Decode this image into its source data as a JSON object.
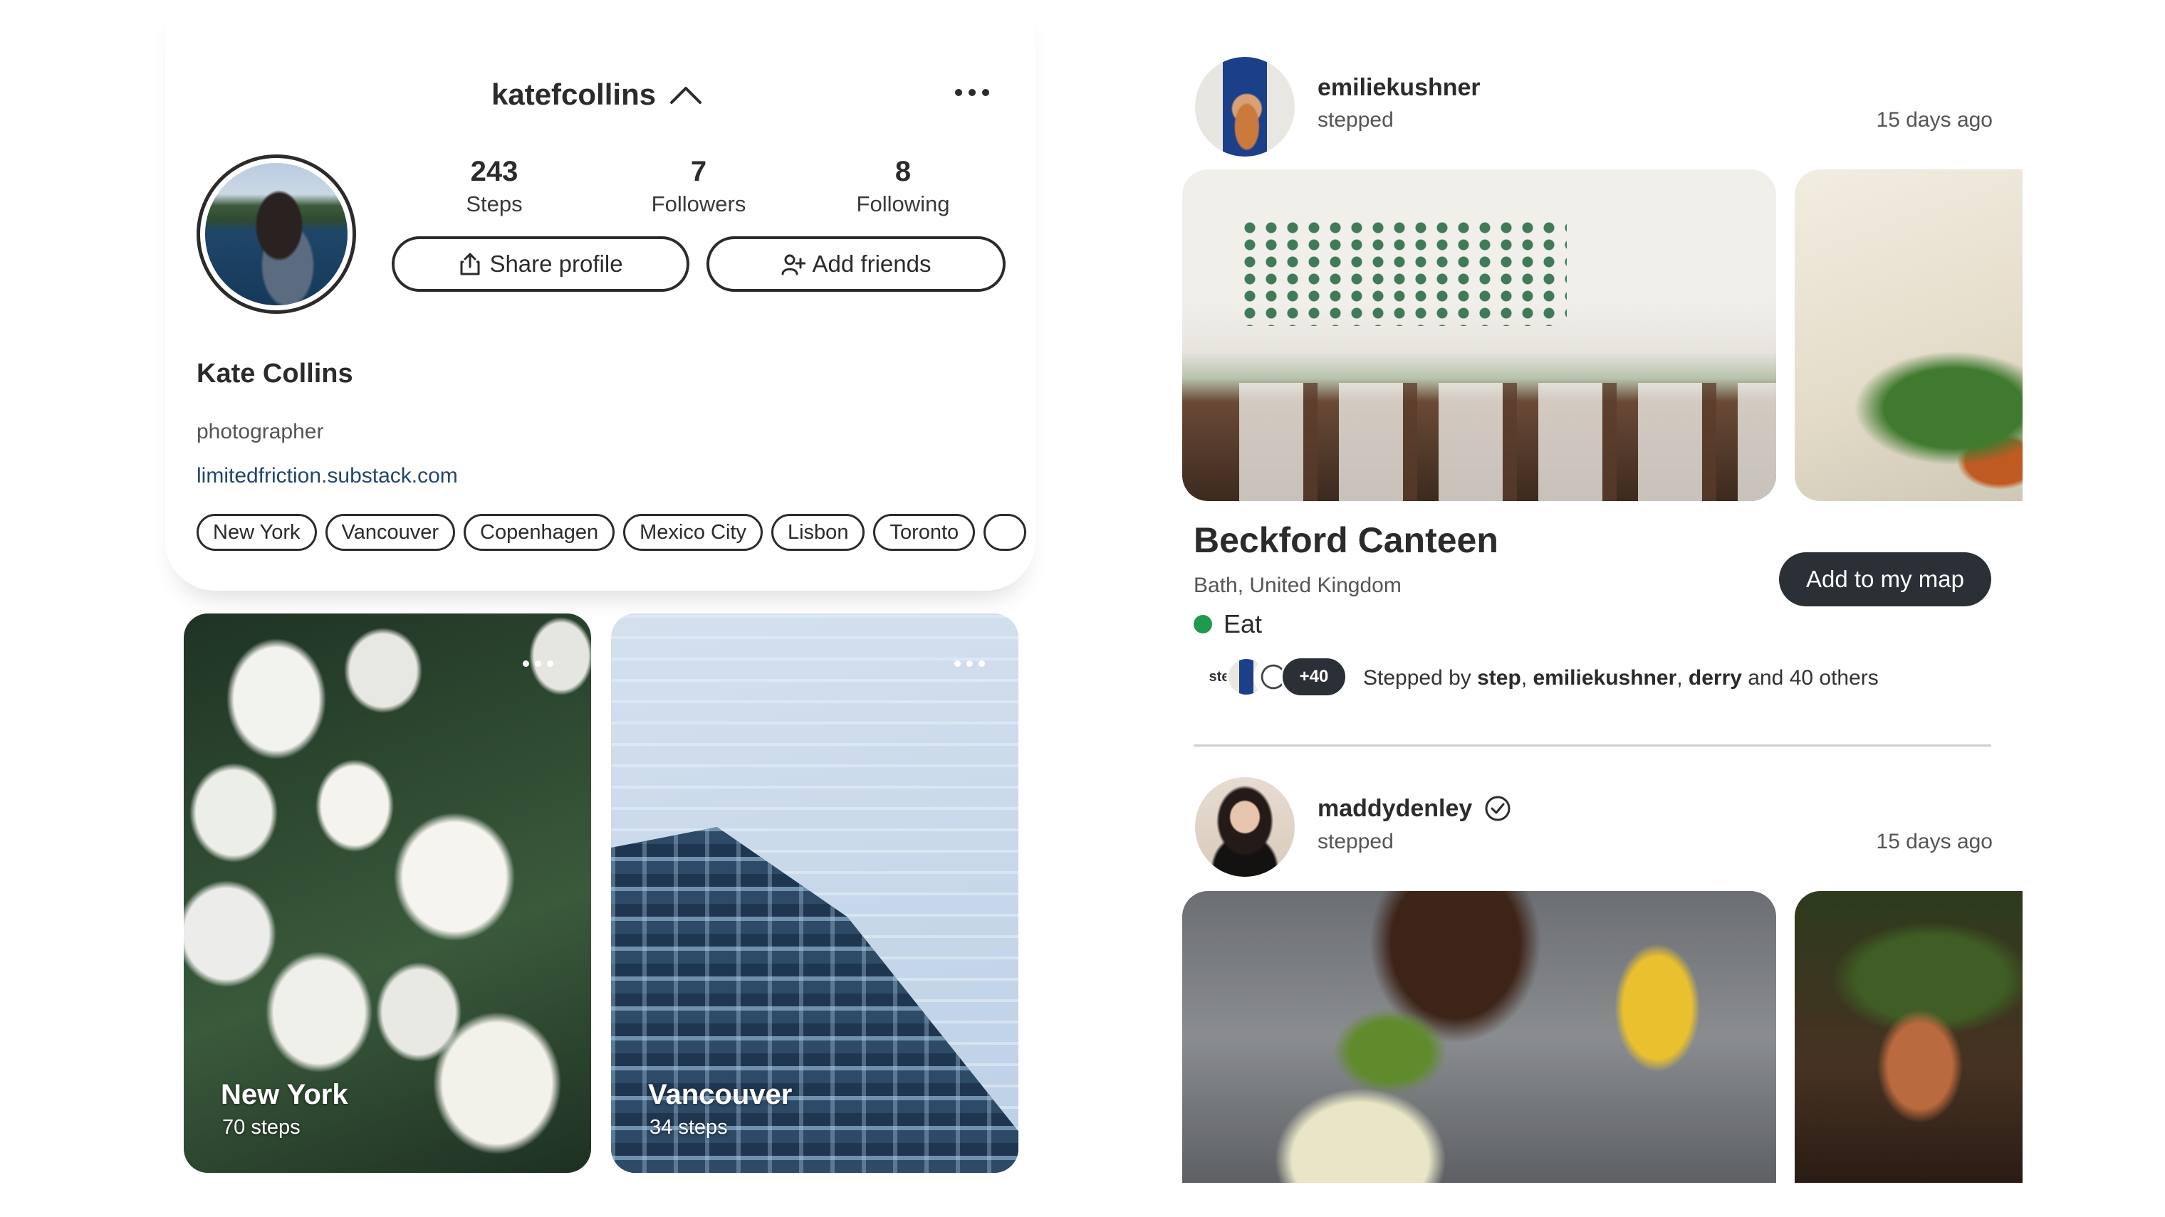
{
  "profile": {
    "username": "katefcollins",
    "stats": [
      {
        "value": "243",
        "label": "Steps"
      },
      {
        "value": "7",
        "label": "Followers"
      },
      {
        "value": "8",
        "label": "Following"
      }
    ],
    "share_label": "Share profile",
    "add_friends_label": "Add friends",
    "full_name": "Kate Collins",
    "bio": "photographer",
    "website": "limitedfriction.substack.com",
    "cities": [
      "New York",
      "Vancouver",
      "Copenhagen",
      "Mexico City",
      "Lisbon",
      "Toronto",
      ""
    ]
  },
  "city_cards": [
    {
      "title": "New York",
      "subtitle": "70 steps"
    },
    {
      "title": "Vancouver",
      "subtitle": "34 steps"
    }
  ],
  "feed": {
    "post1": {
      "username": "emiliekushner",
      "verb": "stepped",
      "time": "15 days ago",
      "place_name": "Beckford Canteen",
      "place_location": "Bath, United Kingdom",
      "category": "Eat",
      "category_color": "#1f9a4e",
      "add_label": "Add to my map",
      "stepper_badge": "ste",
      "more_count": "+40",
      "stepped_prefix": "Stepped by ",
      "stepped_user1": "step",
      "sep1": ", ",
      "stepped_user2": "emiliekushner",
      "sep2": ", ",
      "stepped_user3": "derry",
      "stepped_suffix": " and 40 others"
    },
    "post2": {
      "username": "maddydenley",
      "verb": "stepped",
      "time": "15 days ago"
    }
  },
  "colors": {
    "accent_dark": "#2b2f36",
    "link": "#23466b"
  }
}
